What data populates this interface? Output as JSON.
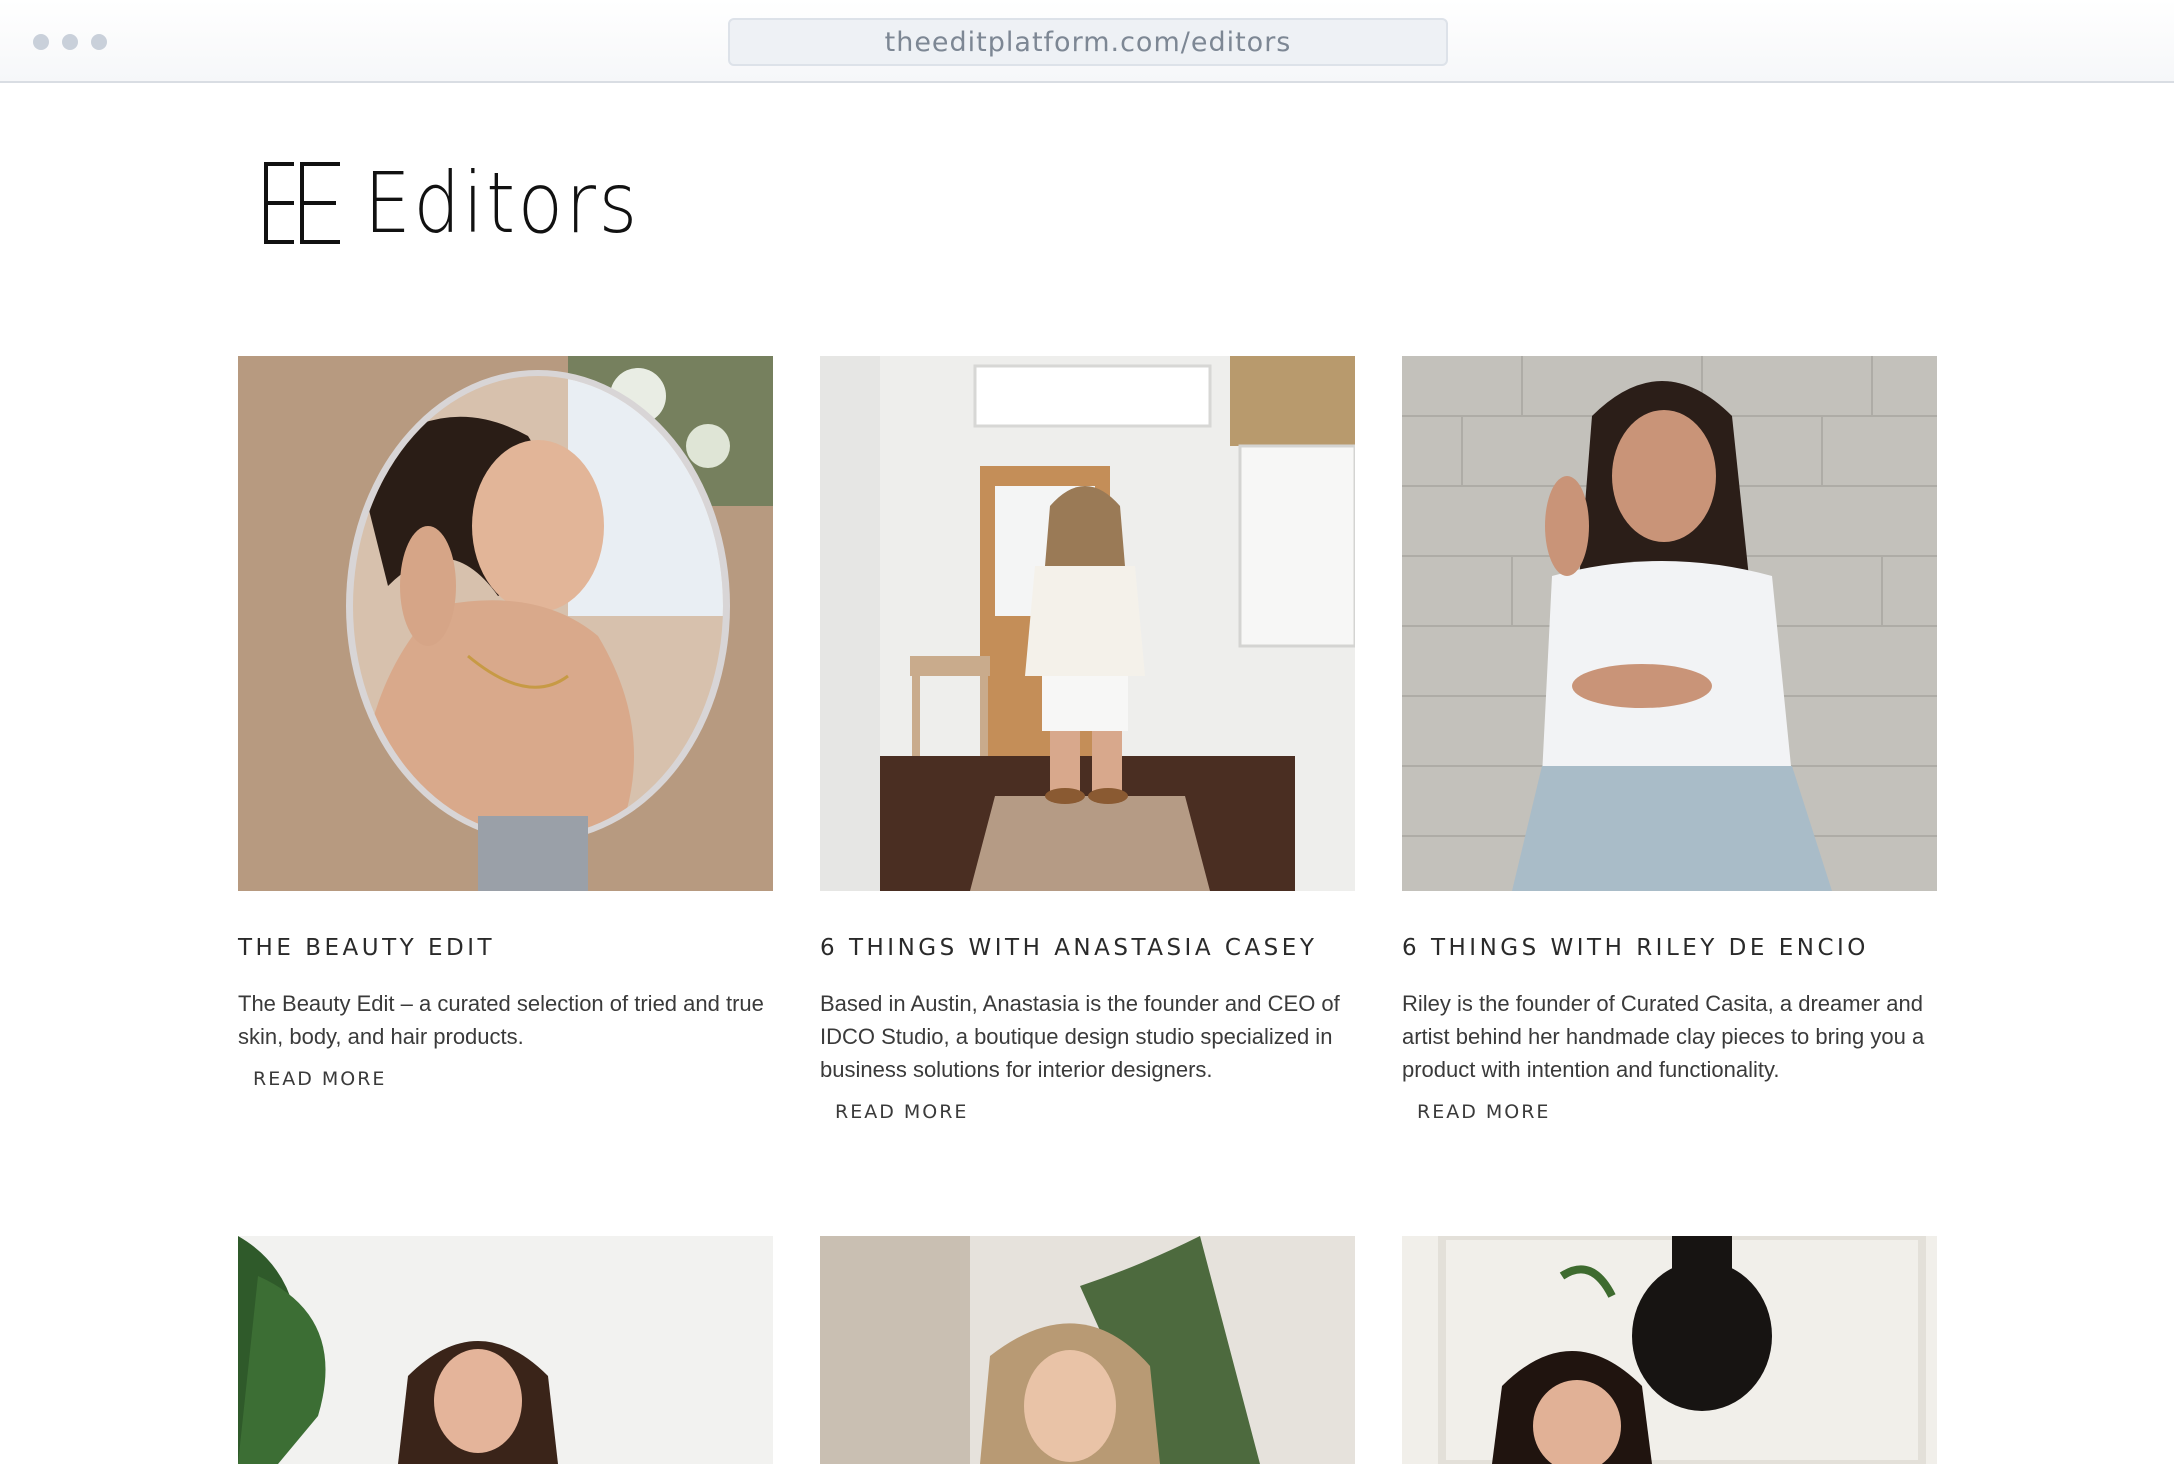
{
  "browser": {
    "url": "theeditplatform.com/editors"
  },
  "header": {
    "title": "Editors"
  },
  "cards": [
    {
      "title": "THE BEAUTY EDIT",
      "description": "The Beauty Edit – a curated selection of tried and true skin, body, and hair products.",
      "cta": "READ MORE"
    },
    {
      "title": "6 THINGS WITH ANASTASIA CASEY",
      "description": "Based in Austin, Anastasia is the founder and CEO of IDCO Studio, a boutique design studio specialized in business solutions for interior designers.",
      "cta": "READ MORE"
    },
    {
      "title": "6 THINGS WITH RILEY DE ENCIO",
      "description": "Riley is the founder of Curated Casita, a dreamer and artist behind her handmade clay pieces to bring you a product with intention and functionality.",
      "cta": "READ MORE"
    }
  ],
  "colors": {
    "text": "#2b2b2b",
    "title": "#111111",
    "url": "#7d8794"
  }
}
